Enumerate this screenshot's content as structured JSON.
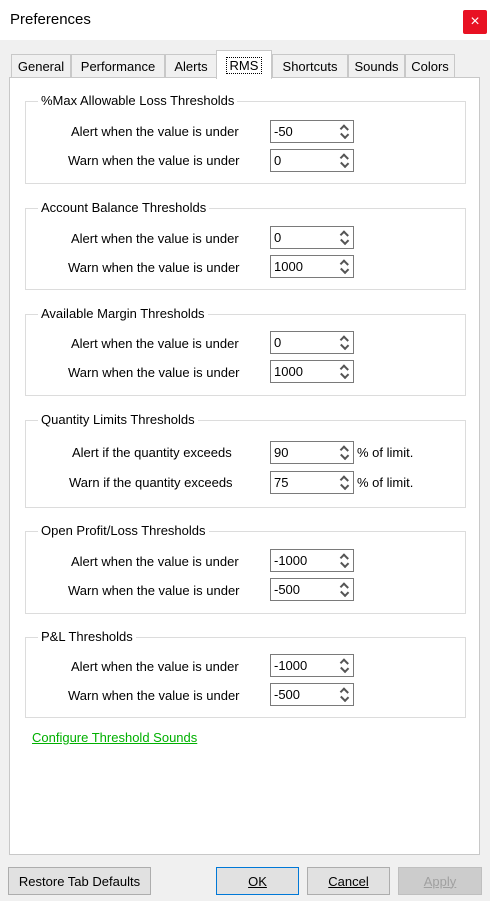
{
  "window": {
    "title": "Preferences",
    "close_glyph": "×"
  },
  "tabs": [
    {
      "label": "General"
    },
    {
      "label": "Performance"
    },
    {
      "label": "Alerts"
    },
    {
      "label": "RMS",
      "active": true
    },
    {
      "label": "Shortcuts"
    },
    {
      "label": "Sounds"
    },
    {
      "label": "Colors"
    }
  ],
  "groups": {
    "max_loss": {
      "title": "%Max Allowable Loss Thresholds",
      "alert_label": "Alert when the value is under",
      "alert_value": "-50",
      "warn_label": "Warn when the value is under",
      "warn_value": "0"
    },
    "account_balance": {
      "title": "Account Balance Thresholds",
      "alert_label": "Alert when the value is under",
      "alert_value": "0",
      "warn_label": "Warn when the value is under",
      "warn_value": "1000"
    },
    "available_margin": {
      "title": "Available Margin Thresholds",
      "alert_label": "Alert when the value is under",
      "alert_value": "0",
      "warn_label": "Warn when the value is under",
      "warn_value": "1000"
    },
    "quantity_limits": {
      "title": "Quantity Limits Thresholds",
      "alert_label": "Alert if the quantity exceeds",
      "alert_value": "90",
      "alert_unit": "% of limit.",
      "warn_label": "Warn if the quantity exceeds",
      "warn_value": "75",
      "warn_unit": "% of limit."
    },
    "open_pl": {
      "title": "Open Profit/Loss Thresholds",
      "alert_label": "Alert when the value is under",
      "alert_value": "-1000",
      "warn_label": "Warn when the value is under",
      "warn_value": "-500"
    },
    "pl": {
      "title": "P&L Thresholds",
      "alert_label": "Alert when the value is under",
      "alert_value": "-1000",
      "warn_label": "Warn when the value is under",
      "warn_value": "-500"
    }
  },
  "link": {
    "label": "Configure Threshold Sounds",
    "color": "#00b000"
  },
  "buttons": {
    "restore": "Restore Tab Defaults",
    "ok": "OK",
    "cancel": "Cancel",
    "apply": "Apply"
  },
  "colors": {
    "close_bg": "#e81123",
    "link": "#00b000",
    "focus": "#0078d7"
  }
}
